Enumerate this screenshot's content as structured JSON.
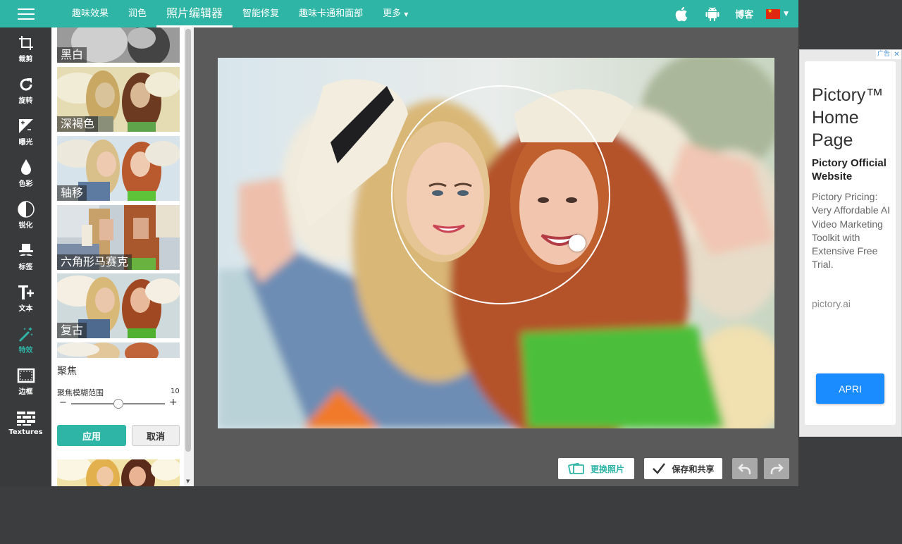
{
  "topbar": {
    "nav": [
      "趣味效果",
      "润色",
      "照片编辑器",
      "智能修复",
      "趣味卡通和面部",
      "更多"
    ],
    "active_index": 2,
    "blog": "博客",
    "icons": [
      "apple-icon",
      "android-icon"
    ],
    "accent": "#2fb5a6"
  },
  "sidebar": {
    "tools": [
      {
        "label": "裁剪",
        "icon": "crop-icon"
      },
      {
        "label": "旋转",
        "icon": "rotate-icon"
      },
      {
        "label": "曝光",
        "icon": "exposure-icon"
      },
      {
        "label": "色彩",
        "icon": "color-drop-icon"
      },
      {
        "label": "锐化",
        "icon": "sharpen-icon"
      },
      {
        "label": "标签",
        "icon": "hat-mustache-icon"
      },
      {
        "label": "文本",
        "icon": "text-icon"
      },
      {
        "label": "特效",
        "icon": "magic-wand-icon"
      },
      {
        "label": "边框",
        "icon": "frame-icon"
      },
      {
        "label": "Textures",
        "icon": "bricks-icon"
      }
    ],
    "active_index": 7
  },
  "panel": {
    "effects": [
      "黑白",
      "深褐色",
      "轴移",
      "六角形马赛克",
      "复古"
    ],
    "section_title": "聚焦",
    "slider": {
      "label": "聚焦模糊范围",
      "value": "10",
      "minus": "−",
      "plus": "+",
      "position": 0.5
    },
    "apply": "应用",
    "cancel": "取消"
  },
  "workspace": {
    "replace_photo": "更换照片",
    "save_share": "保存和共享"
  },
  "ad": {
    "badge": "广告",
    "close": "✕",
    "title": "Pictory™ Home Page",
    "subtitle": "Pictory Official Website",
    "body": "Pictory Pricing: Very Affordable AI Video Marketing Toolkit with Extensive Free Trial.",
    "url": "pictory.ai",
    "cta": "APRI"
  }
}
